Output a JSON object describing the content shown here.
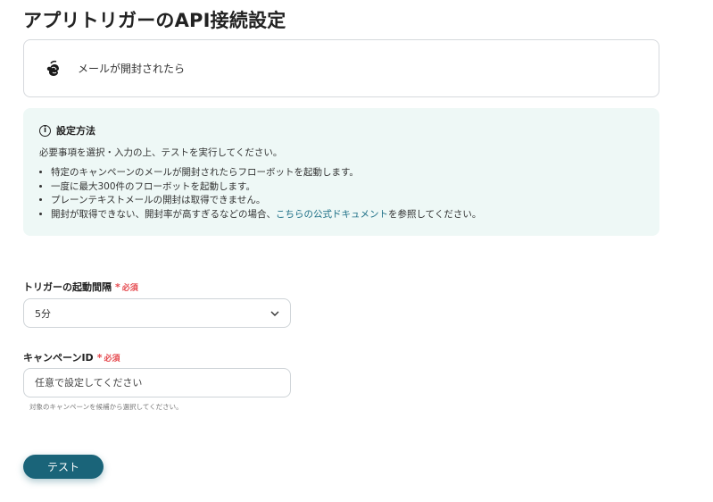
{
  "page": {
    "title": "アプリトリガーのAPI接続設定"
  },
  "trigger_card": {
    "app_icon": "mailchimp-logo",
    "label": "メールが開封されたら"
  },
  "info": {
    "title": "設定方法",
    "intro": "必要事項を選択・入力の上、テストを実行してください。",
    "bullets": [
      "特定のキャンペーンのメールが開封されたらフローボットを起動します。",
      "一度に最大300件のフローボットを起動します。",
      "プレーンテキストメールの開封は取得できません。"
    ],
    "last_bullet_prefix": "開封が取得できない、開封率が高すぎるなどの場合、",
    "last_bullet_link": "こちらの公式ドキュメント",
    "last_bullet_suffix": "を参照してください。"
  },
  "interval_field": {
    "label": "トリガーの起動間隔",
    "required_mark": "*",
    "required_text": "必須",
    "value": "5分"
  },
  "campaign_field": {
    "label": "キャンペーンID",
    "required_mark": "*",
    "required_text": "必須",
    "placeholder": "任意で設定してください",
    "help": "対象のキャンペーンを候補から選択してください。"
  },
  "actions": {
    "test_label": "テスト"
  },
  "colors": {
    "accent": "#1a6479",
    "info_bg": "#eef8f6",
    "required": "#e5484d",
    "link": "#1d6f86"
  }
}
